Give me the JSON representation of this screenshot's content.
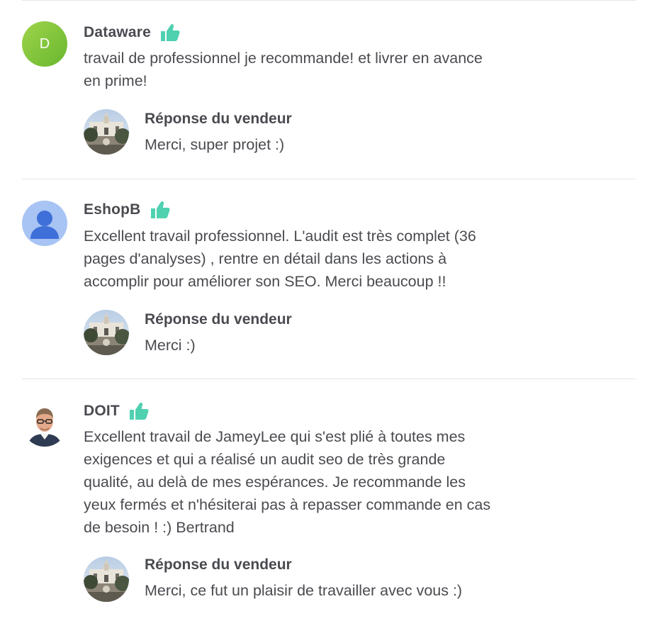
{
  "reviews": [
    {
      "username": "Dataware",
      "avatar": {
        "type": "letter",
        "letter": "D",
        "color": "#8dc63f"
      },
      "rating_icon": "thumbs-up-icon",
      "comment_lines": [
        "travail de professionnel je recommande! et livrer en avance",
        "en prime!"
      ],
      "seller_reply": {
        "title": "Réponse du vendeur",
        "text": "Merci, super projet :)"
      }
    },
    {
      "username": "EshopB",
      "avatar": {
        "type": "default-user-icon",
        "color": "#a8c4f5"
      },
      "rating_icon": "thumbs-up-icon",
      "comment_lines": [
        "Excellent travail professionnel. L'audit est très complet (36",
        "pages d'analyses) , rentre en détail dans les actions à",
        "accomplir pour améliorer son SEO. Merci beaucoup !!"
      ],
      "seller_reply": {
        "title": "Réponse du vendeur",
        "text": "Merci :)"
      }
    },
    {
      "username": "DOIT",
      "avatar": {
        "type": "photo"
      },
      "rating_icon": "thumbs-up-icon",
      "comment_lines": [
        "Excellent travail de JameyLee qui s'est plié à toutes mes",
        "exigences et qui a réalisé un audit seo de très grande",
        "qualité, au delà de mes espérances. Je recommande les",
        "yeux fermés et n'hésiterai pas à repasser commande en cas",
        "de besoin ! :) Bertrand"
      ],
      "seller_reply": {
        "title": "Réponse du vendeur",
        "text": "Merci, ce fut un plaisir de travailler avec vous :)"
      }
    }
  ],
  "colors": {
    "thumb": "#4fd1b0",
    "text": "#4a4b50",
    "divider": "#e4e5e7"
  }
}
